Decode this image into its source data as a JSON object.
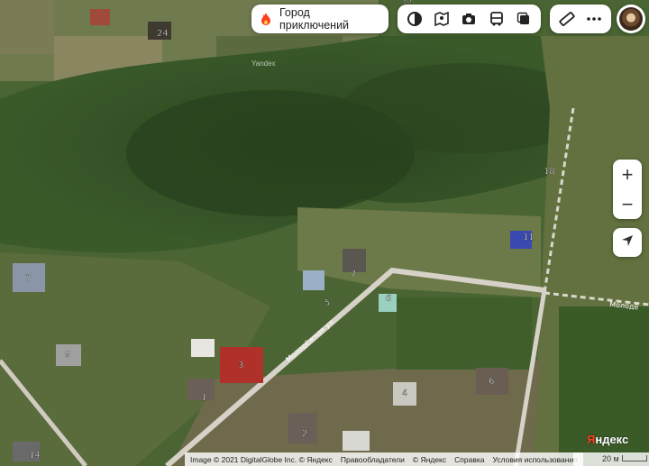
{
  "promo": {
    "label": "Город приключений",
    "icon": "fire-icon"
  },
  "layer_buttons": [
    {
      "name": "layers-icon"
    },
    {
      "name": "atlas-icon"
    },
    {
      "name": "camera-icon"
    },
    {
      "name": "bus-icon"
    },
    {
      "name": "copy-icon"
    }
  ],
  "tool_buttons": [
    {
      "name": "ruler-icon"
    },
    {
      "name": "more-icon"
    }
  ],
  "zoom": {
    "in": "+",
    "out": "−"
  },
  "watermark": "Yandex",
  "road_label": "Молодёжная ул.",
  "road_label_2": "Молодё",
  "copyright": {
    "text": "Image © 2021 DigitalGlobe Inc. © Яндекс",
    "rights": "Правообладатели",
    "yandex": "© Яндекс",
    "help": "Справка",
    "terms": "Условия использования"
  },
  "logo": {
    "first": "Я",
    "rest": "ндекс"
  },
  "scale_label": "20 м",
  "house_numbers": [
    "24",
    "30",
    "18",
    "11",
    "7",
    "7",
    "5",
    "6",
    "9",
    "3",
    "1",
    "4",
    "6",
    "2",
    "14"
  ],
  "colors": {
    "accent": "#fc3f1d",
    "road": "#d6d2c8",
    "forest": "#2f4a22"
  }
}
